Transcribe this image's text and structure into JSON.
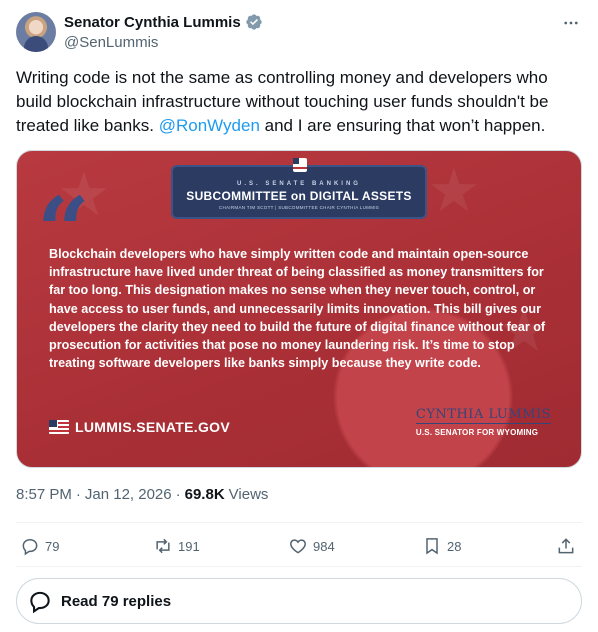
{
  "author": {
    "name": "Senator Cynthia Lummis",
    "handle": "@SenLummis"
  },
  "tweet": {
    "text_before": "Writing code is not the same as controlling money and developers who build blockchain infrastructure without touching user funds shouldn't be treated like banks. ",
    "mention": "@RonWyden",
    "text_after": " and I are ensuring that won’t happen."
  },
  "media": {
    "banner_top": "U.S. SENATE BANKING",
    "banner_main": "SUBCOMMITTEE on DIGITAL ASSETS",
    "banner_sub": "CHAIRMAN TIM SCOTT | SUBCOMMITTEE CHAIR CYNTHIA LUMMIS",
    "quote_mark": "“",
    "quote": "Blockchain developers who have simply written code and maintain open-source infrastructure have lived under threat of being classified as money transmitters for far too long. This designation makes no sense when they never touch, control, or have access to user funds, and unnecessarily limits innovation. This bill gives our developers the clarity they need to build the future of digital finance without fear of prosecution for activities that pose no money laundering risk. It’s time to stop treating software developers like banks simply because they write code.",
    "site": "LUMMIS.SENATE.GOV",
    "signature": "CYNTHIA LUMMIS",
    "signature_title": "U.S. SENATOR FOR WYOMING",
    "colors": {
      "background": "#aa3036",
      "banner": "#2b3b62",
      "quote_mark": "#3b4f86"
    }
  },
  "meta": {
    "time": "8:57 PM",
    "sep1": "·",
    "date": "Jan 12, 2026",
    "sep2": "·",
    "views_count": "69.8K",
    "views_label": "Views"
  },
  "actions": {
    "replies": "79",
    "reposts": "191",
    "likes": "984",
    "bookmarks": "28"
  },
  "read_replies": "Read 79 replies",
  "icons": [
    "verified-icon",
    "more-icon",
    "reply-icon",
    "repost-icon",
    "like-icon",
    "bookmark-icon",
    "share-icon",
    "replies-bubble-icon"
  ],
  "accent_color": "#1d9bf0"
}
